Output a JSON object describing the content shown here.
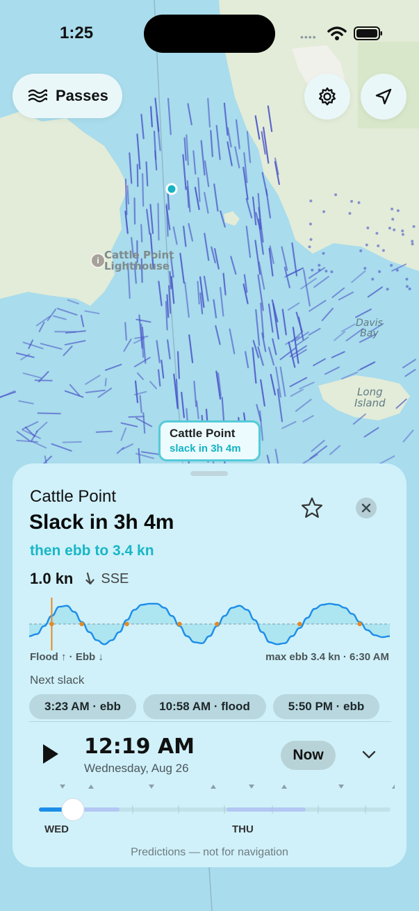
{
  "status_bar": {
    "time": "1:25"
  },
  "top_controls": {
    "passes_label": "Passes",
    "passes_icon": "waves-icon",
    "settings_icon": "gear-icon",
    "locate_icon": "location-arrow-icon"
  },
  "map": {
    "labels": {
      "lighthouse": "Cattle Point\nLighthouse",
      "davis_bay": "Davis\nBay",
      "long_island": "Long\nIsland"
    },
    "colors": {
      "water": "#a9dcec",
      "land": "#e3ecd8",
      "current_arrows": "#4a55c8",
      "station_dot": "#16b3c3"
    }
  },
  "callout": {
    "name": "Cattle Point",
    "subtitle": "slack in 3h 4m"
  },
  "sheet": {
    "station_name": "Cattle Point",
    "headline": "Slack in 3h 4m",
    "subhead": "then ebb to 3.4 kn",
    "speed": "1.0 kn",
    "direction": "SSE",
    "legend_left": "Flood ↑ · Ebb ↓",
    "legend_right": "max ebb 3.4 kn · 6:30 AM",
    "next_slack_label": "Next slack",
    "slack_chips": [
      "3:23 AM · ebb",
      "10:58 AM · flood",
      "5:50 PM · ebb"
    ],
    "time": "12:19 AM",
    "date": "Wednesday, Aug 26",
    "now_label": "Now",
    "day_labels": [
      "WED",
      "THU"
    ],
    "disclaimer": "Predictions — not for navigation",
    "accent_color": "#19b6c6",
    "now_marker_color": "#e58a22"
  },
  "chart_data": {
    "type": "line",
    "description_units": "relative current speed; positive = flood, negative = ebb",
    "x": [
      0,
      1,
      2,
      3,
      4,
      5,
      6,
      7,
      8,
      9,
      10,
      11,
      12,
      13,
      14,
      15,
      16,
      17,
      18,
      19,
      20,
      21,
      22,
      23,
      24,
      25,
      26,
      27,
      28,
      29,
      30,
      31,
      32,
      33,
      34,
      35,
      36,
      37,
      38,
      39,
      40,
      41,
      42,
      43,
      44,
      45,
      46,
      47,
      48
    ],
    "values": [
      -0.6,
      -0.5,
      -0.1,
      0.4,
      0.85,
      0.9,
      0.6,
      0.1,
      -0.4,
      -0.8,
      -1.0,
      -0.8,
      -0.4,
      0.2,
      0.7,
      0.95,
      1.0,
      1.0,
      0.8,
      0.4,
      -0.1,
      -0.6,
      -0.9,
      -0.95,
      -0.6,
      -0.1,
      0.4,
      0.8,
      0.9,
      0.7,
      0.2,
      -0.4,
      -0.9,
      -1.0,
      -0.95,
      -0.6,
      -0.2,
      0.3,
      0.75,
      0.95,
      1.0,
      0.95,
      0.8,
      0.5,
      0.1,
      -0.3,
      -0.55,
      -0.65,
      -0.6
    ],
    "slack_marks_x": [
      3,
      7,
      13,
      20,
      25,
      36,
      44
    ],
    "now_x": 3,
    "ylim": [
      -1.2,
      1.2
    ]
  }
}
